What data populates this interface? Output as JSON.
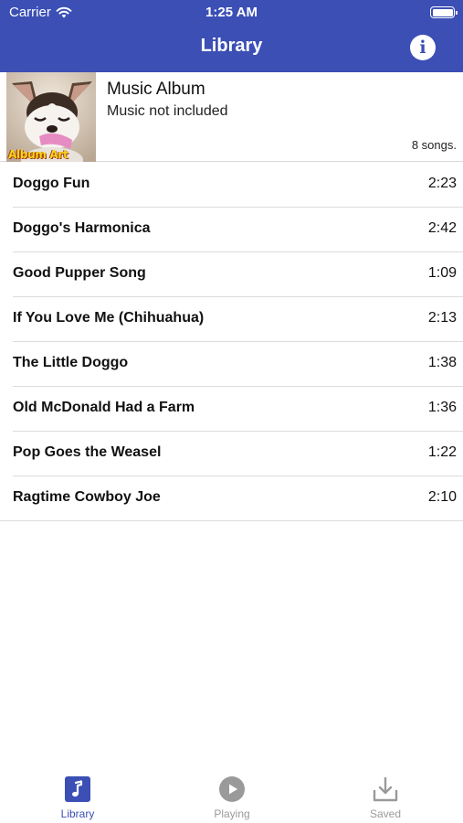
{
  "status_bar": {
    "carrier": "Carrier",
    "time": "1:25 AM"
  },
  "nav": {
    "title": "Library",
    "info_icon": "info-icon"
  },
  "album": {
    "art_caption": "Album Art",
    "title": "Music Album",
    "subtitle": "Music not included",
    "song_count": "8 songs."
  },
  "songs": [
    {
      "title": "Doggo Fun",
      "duration": "2:23"
    },
    {
      "title": "Doggo's Harmonica",
      "duration": "2:42"
    },
    {
      "title": "Good Pupper Song",
      "duration": "1:09"
    },
    {
      "title": "If You Love Me (Chihuahua)",
      "duration": "2:13"
    },
    {
      "title": "The Little Doggo",
      "duration": "1:38"
    },
    {
      "title": "Old McDonald Had a Farm",
      "duration": "1:36"
    },
    {
      "title": "Pop Goes the Weasel",
      "duration": "1:22"
    },
    {
      "title": "Ragtime Cowboy Joe",
      "duration": "2:10"
    }
  ],
  "tabs": [
    {
      "label": "Library",
      "icon": "music-note-icon",
      "active": true
    },
    {
      "label": "Playing",
      "icon": "play-circle-icon",
      "active": false
    },
    {
      "label": "Saved",
      "icon": "download-icon",
      "active": false
    }
  ],
  "colors": {
    "accent": "#3b4fb5",
    "inactive": "#9a9a9a"
  }
}
